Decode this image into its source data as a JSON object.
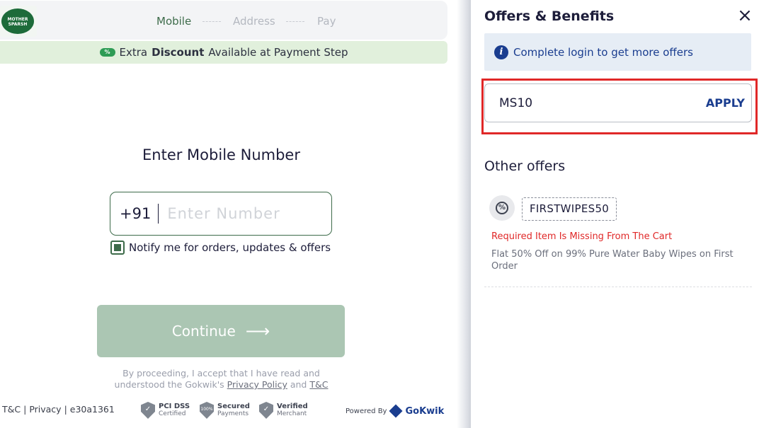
{
  "brand": {
    "logo_text": "MOTHER SPARSH"
  },
  "stepper": {
    "steps": [
      "Mobile",
      "Address",
      "Pay"
    ],
    "active_index": 0
  },
  "promo": {
    "icon": "%",
    "prefix": "Extra",
    "bold": "Discount",
    "suffix": "Available at Payment Step"
  },
  "login": {
    "heading": "Enter Mobile Number",
    "country_code": "+91",
    "phone_placeholder": "Enter Number",
    "phone_value": "",
    "notify_label": "Notify me for orders, updates & offers",
    "notify_checked": true,
    "continue_label": "Continue",
    "continue_arrow": "⟶"
  },
  "disclaimer": {
    "text": "By proceeding, I accept that I have read and understood the Gokwik's",
    "privacy_link": "Privacy Policy",
    "and": "and",
    "tc_link": "T&C"
  },
  "footer": {
    "tc": "T&C",
    "sep1": "|",
    "privacy": "Privacy",
    "sep2": "|",
    "build_id": "e30a1361",
    "badges": [
      {
        "icon": "✓",
        "title": "PCI DSS",
        "subtitle": "Certified"
      },
      {
        "icon": "100%",
        "title": "Secured",
        "subtitle": "Payments"
      },
      {
        "icon": "✓",
        "title": "Verified",
        "subtitle": "Merchant"
      }
    ],
    "powered_by": "Powered By",
    "powered_brand": "GoKwik"
  },
  "offers_panel": {
    "title": "Offers & Benefits",
    "close_icon": "×",
    "login_banner": "Complete login to get more offers",
    "info_icon": "i",
    "coupon_value": "MS10",
    "apply_label": "APPLY",
    "other_title": "Other offers",
    "offers": [
      {
        "code": "FIRSTWIPES50",
        "icon": "%",
        "error": "Required Item Is Missing From The Cart",
        "description": "Flat 50% Off on 99% Pure Water Baby Wipes on First Order"
      }
    ]
  },
  "colors": {
    "brand_green": "#3d6b4a",
    "continue_disabled": "#abc6b3",
    "link_blue": "#1a3d8f",
    "error_red": "#e02828",
    "highlight": "#e02828"
  }
}
